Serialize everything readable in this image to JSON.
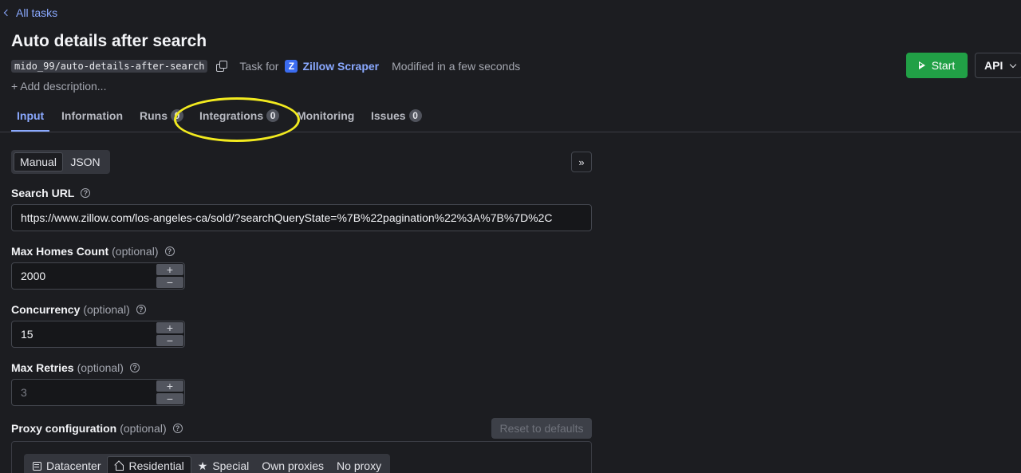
{
  "header": {
    "back_label": "All tasks",
    "title": "Auto details after search",
    "slug": "mido_99/auto-details-after-search",
    "task_for_label": "Task for",
    "actor_logo_letter": "Z",
    "actor_name": "Zillow Scraper",
    "modified": "Modified in a few seconds",
    "add_description": "+ Add description...",
    "start_label": "Start",
    "api_label": "API"
  },
  "tabs": [
    {
      "label": "Input",
      "active": true
    },
    {
      "label": "Information"
    },
    {
      "label": "Runs",
      "count": "0"
    },
    {
      "label": "Integrations",
      "count": "0"
    },
    {
      "label": "Monitoring"
    },
    {
      "label": "Issues",
      "count": "0"
    }
  ],
  "input_mode": {
    "manual_label": "Manual",
    "json_label": "JSON",
    "selected": "Manual",
    "expand_glyph": "»"
  },
  "form": {
    "search_url": {
      "label": "Search URL",
      "value": "https://www.zillow.com/los-angeles-ca/sold/?searchQueryState=%7B%22pagination%22%3A%7B%7D%2C"
    },
    "max_homes": {
      "label": "Max Homes Count",
      "optional": "(optional)",
      "value": "2000"
    },
    "concurrency": {
      "label": "Concurrency",
      "optional": "(optional)",
      "value": "15"
    },
    "max_retries": {
      "label": "Max Retries",
      "optional": "(optional)",
      "placeholder": "3"
    },
    "proxy": {
      "label": "Proxy configuration",
      "optional": "(optional)",
      "reset_label": "Reset to defaults",
      "options": [
        "Datacenter",
        "Residential",
        "Special",
        "Own proxies",
        "No proxy"
      ],
      "selected": "Residential"
    }
  },
  "colors": {
    "accent": "#8aa9ff",
    "start_green": "#21a046",
    "highlight_yellow": "#f2ea1f"
  }
}
